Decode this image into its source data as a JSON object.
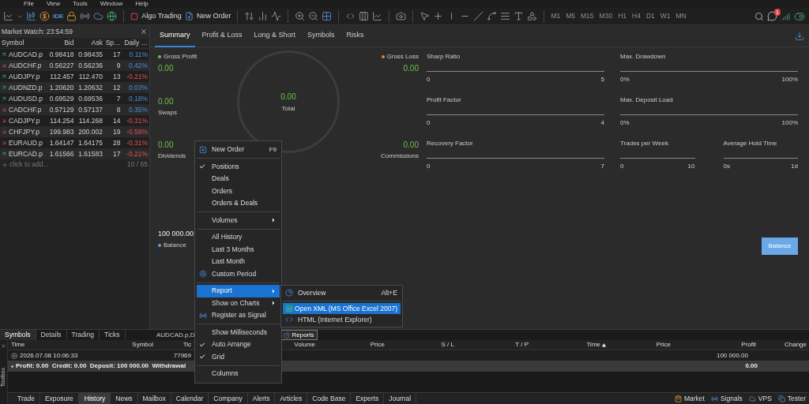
{
  "menu_bar": [
    "File",
    "View",
    "Tools",
    "Window",
    "Help"
  ],
  "toolbar": {
    "ide_label": "IDE",
    "algo_trading": "Algo Trading",
    "new_order": "New Order",
    "timeframes": [
      "M1",
      "M5",
      "M15",
      "M30",
      "H1",
      "H4",
      "D1",
      "W1",
      "MN"
    ],
    "notification_count": "1"
  },
  "market_watch": {
    "title": "Market Watch: 23:54:59",
    "columns": [
      "Symbol",
      "Bid",
      "Ask",
      "Sp…",
      "Daily …"
    ],
    "rows": [
      {
        "symbol": "AUDCAD.p",
        "bid": "0.98418",
        "ask": "0.98435",
        "spread": "17",
        "daily": "0.11%",
        "rising": true,
        "negative": false
      },
      {
        "symbol": "AUDCHF.p",
        "bid": "0.56227",
        "ask": "0.56236",
        "spread": "9",
        "daily": "0.42%",
        "rising": false,
        "negative": false
      },
      {
        "symbol": "AUDJPY.p",
        "bid": "112.457",
        "ask": "112.470",
        "spread": "13",
        "daily": "-0.21%",
        "rising": true,
        "negative": true
      },
      {
        "symbol": "AUDNZD.p",
        "bid": "1.20620",
        "ask": "1.20632",
        "spread": "12",
        "daily": "0.03%",
        "rising": true,
        "negative": false
      },
      {
        "symbol": "AUDUSD.p",
        "bid": "0.69529",
        "ask": "0.69536",
        "spread": "7",
        "daily": "0.18%",
        "rising": true,
        "negative": false
      },
      {
        "symbol": "CADCHF.p",
        "bid": "0.57129",
        "ask": "0.57137",
        "spread": "8",
        "daily": "0.35%",
        "rising": false,
        "negative": false
      },
      {
        "symbol": "CADJPY.p",
        "bid": "114.254",
        "ask": "114.268",
        "spread": "14",
        "daily": "-0.31%",
        "rising": false,
        "negative": true
      },
      {
        "symbol": "CHFJPY.p",
        "bid": "199.983",
        "ask": "200.002",
        "spread": "19",
        "daily": "-0.58%",
        "rising": false,
        "negative": true
      },
      {
        "symbol": "EURAUD.p",
        "bid": "1.64147",
        "ask": "1.64175",
        "spread": "28",
        "daily": "-0.31%",
        "rising": false,
        "negative": true
      },
      {
        "symbol": "EURCAD.p",
        "bid": "1.61566",
        "ask": "1.61583",
        "spread": "17",
        "daily": "-0.21%",
        "rising": true,
        "negative": true
      }
    ],
    "add_label": "click to add...",
    "count": "10 / 65"
  },
  "market_watch_tabs": [
    {
      "label": "Symbols",
      "selected": true
    },
    {
      "label": "Details",
      "selected": false
    },
    {
      "label": "Trading",
      "selected": false
    },
    {
      "label": "Ticks",
      "selected": false
    }
  ],
  "chart_tabs": [
    {
      "label": "AUDCAD.p,D",
      "selected": false
    },
    {
      "label": "Reports",
      "selected": true
    }
  ],
  "report": {
    "tabs": [
      {
        "label": "Summary",
        "selected": true
      },
      {
        "label": "Profit & Loss",
        "selected": false
      },
      {
        "label": "Long & Short",
        "selected": false
      },
      {
        "label": "Symbols",
        "selected": false
      },
      {
        "label": "Risks",
        "selected": false
      }
    ],
    "gross_profit": {
      "label": "Gross Profit",
      "value": "0.00",
      "color": "#6cc04a"
    },
    "gross_loss": {
      "label": "Gross Loss",
      "value": "0.00",
      "color": "#e8804a"
    },
    "total": {
      "label": "Total",
      "value": "0.00"
    },
    "swaps": {
      "label": "Swaps",
      "value": "0.00"
    },
    "dividends": {
      "label": "Dividends",
      "value": "0.00"
    },
    "commissions": {
      "label": "Commissions",
      "value": "0.00"
    },
    "balance": {
      "label": "Balance",
      "value": "100 000.00",
      "color": "#5aa0e8"
    },
    "metrics": [
      {
        "label": "Sharp Ratio",
        "min": "0",
        "max": "5"
      },
      {
        "label": "Max. Drawdown",
        "min": "0%",
        "max": "100%"
      },
      {
        "label": "Profit Factor",
        "min": "0",
        "max": "4"
      },
      {
        "label": "Max. Deposit Load",
        "min": "0%",
        "max": "100%"
      },
      {
        "label": "Recovery Factor",
        "min": "0",
        "max": "7"
      },
      {
        "label": "Trades per Week",
        "min": "0",
        "max": "10"
      },
      {
        "label": "Average Hold Time",
        "min": "0s",
        "max": "1d"
      }
    ],
    "balance_button": "Balance"
  },
  "context_menu": [
    {
      "kind": "command",
      "label": "New Order",
      "shortcut": "F9",
      "checked": false,
      "selected": false,
      "submenu": false
    },
    {
      "kind": "separator"
    },
    {
      "kind": "command",
      "label": "Positions",
      "checked": true,
      "selected": false,
      "submenu": false
    },
    {
      "kind": "command",
      "label": "Deals",
      "checked": false,
      "selected": false,
      "submenu": false
    },
    {
      "kind": "command",
      "label": "Orders",
      "checked": false,
      "selected": false,
      "submenu": false
    },
    {
      "kind": "command",
      "label": "Orders & Deals",
      "checked": false,
      "selected": false,
      "submenu": false
    },
    {
      "kind": "separator"
    },
    {
      "kind": "command",
      "label": "Volumes",
      "checked": false,
      "selected": false,
      "submenu": true
    },
    {
      "kind": "separator"
    },
    {
      "kind": "command",
      "label": "All History",
      "checked": false,
      "selected": false,
      "submenu": false
    },
    {
      "kind": "command",
      "label": "Last 3 Months",
      "checked": false,
      "selected": false,
      "submenu": false
    },
    {
      "kind": "command",
      "label": "Last Month",
      "checked": false,
      "selected": false,
      "submenu": false
    },
    {
      "kind": "command",
      "label": "Custom Period",
      "checked": false,
      "selected": false,
      "submenu": false
    },
    {
      "kind": "separator"
    },
    {
      "kind": "command",
      "label": "Report",
      "checked": false,
      "selected": true,
      "submenu": true
    },
    {
      "kind": "command",
      "label": "Show on Charts",
      "checked": false,
      "selected": false,
      "submenu": true
    },
    {
      "kind": "command",
      "label": "Register as Signal",
      "checked": false,
      "selected": false,
      "submenu": false
    },
    {
      "kind": "separator"
    },
    {
      "kind": "command",
      "label": "Show Milliseconds",
      "checked": false,
      "selected": false,
      "submenu": false
    },
    {
      "kind": "command",
      "label": "Auto Arrange",
      "checked": true,
      "selected": false,
      "submenu": false
    },
    {
      "kind": "command",
      "label": "Grid",
      "checked": true,
      "selected": false,
      "submenu": false
    },
    {
      "kind": "separator"
    },
    {
      "kind": "command",
      "label": "Columns",
      "checked": false,
      "selected": false,
      "submenu": false
    }
  ],
  "report_submenu": [
    {
      "kind": "command",
      "label": "Overview",
      "shortcut": "Alt+E",
      "selected": false
    },
    {
      "kind": "separator"
    },
    {
      "kind": "command",
      "label": "Open XML (MS Office Excel 2007)",
      "selected": true
    },
    {
      "kind": "command",
      "label": "HTML (Internet Explorer)",
      "selected": false
    }
  ],
  "toolbox": {
    "title": "Toolbox",
    "columns": [
      {
        "label": "Time",
        "sorted": false
      },
      {
        "label": "Symbol",
        "sorted": false
      },
      {
        "label": "Tic",
        "sorted": false
      },
      {
        "label": "Volume",
        "sorted": false
      },
      {
        "label": "Price",
        "sorted": false
      },
      {
        "label": "S / L",
        "sorted": false
      },
      {
        "label": "T / P",
        "sorted": false
      },
      {
        "label": "Time",
        "sorted": true
      },
      {
        "label": "Price",
        "sorted": false
      },
      {
        "label": "Profit",
        "sorted": false
      },
      {
        "label": "Change",
        "sorted": false
      }
    ],
    "row": {
      "time": "2026.07.08 10:06:33",
      "ticket": "77969",
      "profit": "100 000.00"
    },
    "summary": {
      "text": "Profit: 0.00  Credit: 0.00  Deposit: 100 000.00  Withdrawal",
      "profit": "0.00"
    },
    "tabs": [
      {
        "label": "Trade",
        "selected": false
      },
      {
        "label": "Exposure",
        "selected": false
      },
      {
        "label": "History",
        "selected": true
      },
      {
        "label": "News",
        "selected": false
      },
      {
        "label": "Mailbox",
        "selected": false
      },
      {
        "label": "Calendar",
        "selected": false
      },
      {
        "label": "Company",
        "selected": false
      },
      {
        "label": "Alerts",
        "selected": false
      },
      {
        "label": "Articles",
        "selected": false
      },
      {
        "label": "Code Base",
        "selected": false
      },
      {
        "label": "Experts",
        "selected": false
      },
      {
        "label": "Journal",
        "selected": false
      }
    ],
    "services": [
      "Market",
      "Signals",
      "VPS",
      "Tester"
    ]
  }
}
